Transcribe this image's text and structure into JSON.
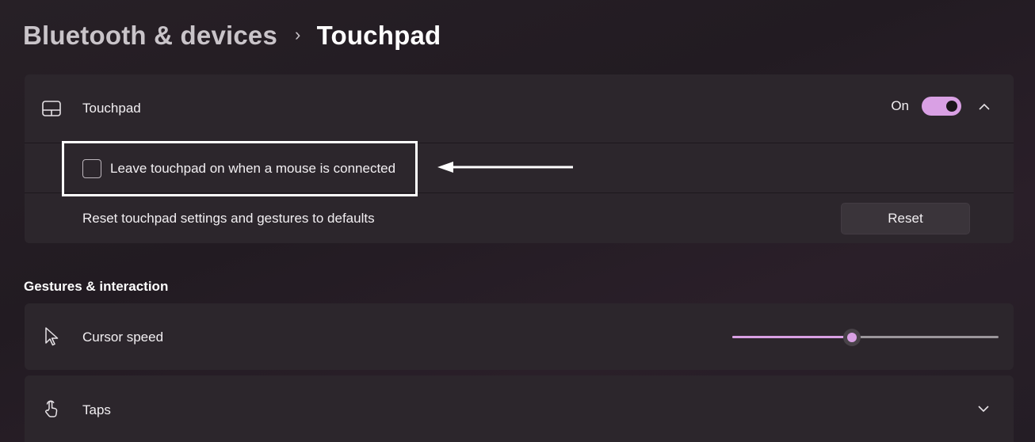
{
  "breadcrumb": {
    "parent": "Bluetooth & devices",
    "separator": "›",
    "current": "Touchpad"
  },
  "touchpad_card": {
    "icon": "touchpad-icon",
    "label": "Touchpad",
    "toggle_state": "On",
    "toggle_on": true,
    "expand_icon": "chevron-up-icon",
    "leave_on": {
      "label": "Leave touchpad on when a mouse is connected",
      "checked": false
    },
    "reset": {
      "label": "Reset touchpad settings and gestures to defaults",
      "button": "Reset"
    }
  },
  "annotation": {
    "highlight": "highlight-box",
    "arrow_icon": "arrow-left-icon"
  },
  "gestures": {
    "title": "Gestures & interaction",
    "cursor_speed": {
      "icon": "cursor-icon",
      "label": "Cursor speed",
      "value_fraction": 0.45
    },
    "taps": {
      "icon": "tap-hand-icon",
      "label": "Taps",
      "expand_icon": "chevron-down-icon"
    }
  },
  "colors": {
    "accent": "#d9a0e4",
    "card": "#2c262c"
  }
}
